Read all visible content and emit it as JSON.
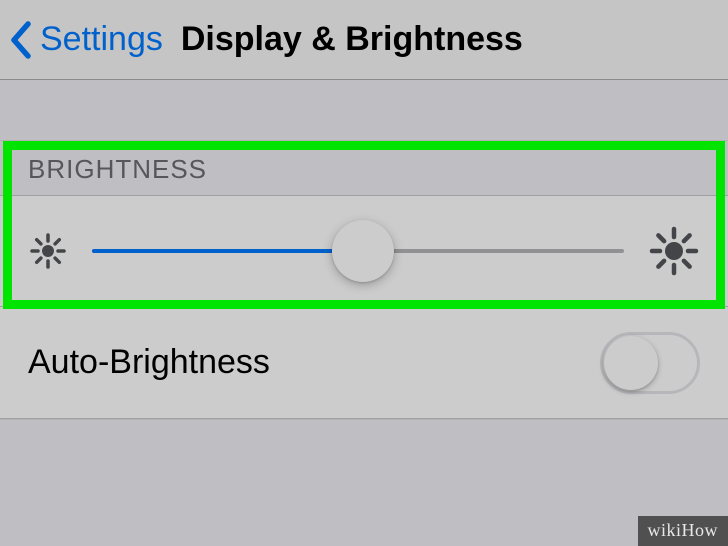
{
  "header": {
    "back_label": "Settings",
    "title": "Display & Brightness"
  },
  "section": {
    "header": "BRIGHTNESS",
    "slider_value_percent": 51
  },
  "auto_row": {
    "label": "Auto-Brightness",
    "enabled": false
  },
  "watermark": "wikiHow",
  "colors": {
    "ios_blue": "#007aff",
    "highlight_green": "#00e400",
    "gray_text": "#6d6d72"
  }
}
